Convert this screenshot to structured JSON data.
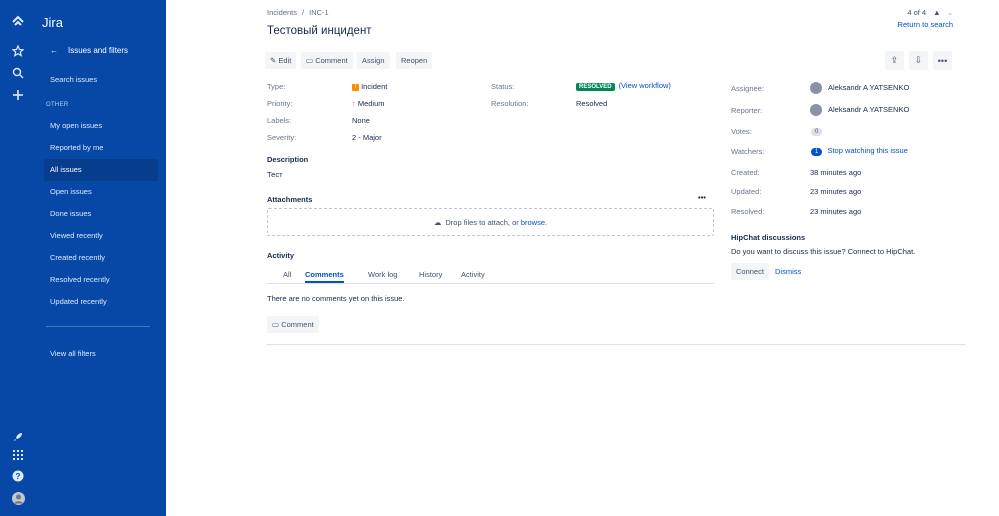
{
  "app": {
    "name": "Jira"
  },
  "sidebar": {
    "back_label": "Issues and filters",
    "search_label": "Search issues",
    "section_heading": "OTHER",
    "items": [
      {
        "label": "My open issues"
      },
      {
        "label": "Reported by me"
      },
      {
        "label": "All issues"
      },
      {
        "label": "Open issues"
      },
      {
        "label": "Done issues"
      },
      {
        "label": "Viewed recently"
      },
      {
        "label": "Created recently"
      },
      {
        "label": "Resolved recently"
      },
      {
        "label": "Updated recently"
      }
    ],
    "view_all_filters": "View all filters"
  },
  "breadcrumb": {
    "project": "Incidents",
    "separator": "/",
    "issue_key": "INC-1"
  },
  "issue": {
    "title": "Тестовый инцидент"
  },
  "pager": {
    "position": "4 of 4",
    "return_label": "Return to search"
  },
  "toolbar": {
    "edit": "Edit",
    "comment": "Comment",
    "assign": "Assign",
    "reopen": "Reopen"
  },
  "details": {
    "type_label": "Type:",
    "type_value": "Incident",
    "priority_label": "Priority:",
    "priority_value": "Medium",
    "labels_label": "Labels:",
    "labels_value": "None",
    "severity_label": "Severity:",
    "severity_value": "2 - Major",
    "status_label": "Status:",
    "status_value": "RESOLVED",
    "view_workflow": "(View workflow)",
    "resolution_label": "Resolution:",
    "resolution_value": "Resolved"
  },
  "description": {
    "heading": "Description",
    "text": "Тест"
  },
  "attachments": {
    "heading": "Attachments",
    "drop_text": "Drop files to attach, or",
    "browse": "browse."
  },
  "activity": {
    "heading": "Activity",
    "tabs": [
      {
        "label": "All"
      },
      {
        "label": "Comments"
      },
      {
        "label": "Work log"
      },
      {
        "label": "History"
      },
      {
        "label": "Activity"
      }
    ],
    "empty_text": "There are no comments yet on this issue.",
    "comment_button": "Comment"
  },
  "people": {
    "assignee_label": "Assignee:",
    "assignee": "Aleksandr A YATSENKO",
    "reporter_label": "Reporter:",
    "reporter": "Aleksandr A YATSENKO",
    "votes_label": "Votes:",
    "votes": "0",
    "watchers_label": "Watchers:",
    "watchers": "1",
    "stop_watching": "Stop watching this issue"
  },
  "dates": {
    "created_label": "Created:",
    "created": "38 minutes ago",
    "updated_label": "Updated:",
    "updated": "23 minutes ago",
    "resolved_label": "Resolved:",
    "resolved": "23 minutes ago"
  },
  "hipchat": {
    "heading": "HipChat discussions",
    "text": "Do you want to discuss this issue? Connect to HipChat.",
    "connect": "Connect",
    "dismiss": "Dismiss"
  },
  "colors": {
    "nav_bg": "#0747a6",
    "link": "#0052cc",
    "resolved": "#00875a",
    "incident": "#ff8b00"
  }
}
